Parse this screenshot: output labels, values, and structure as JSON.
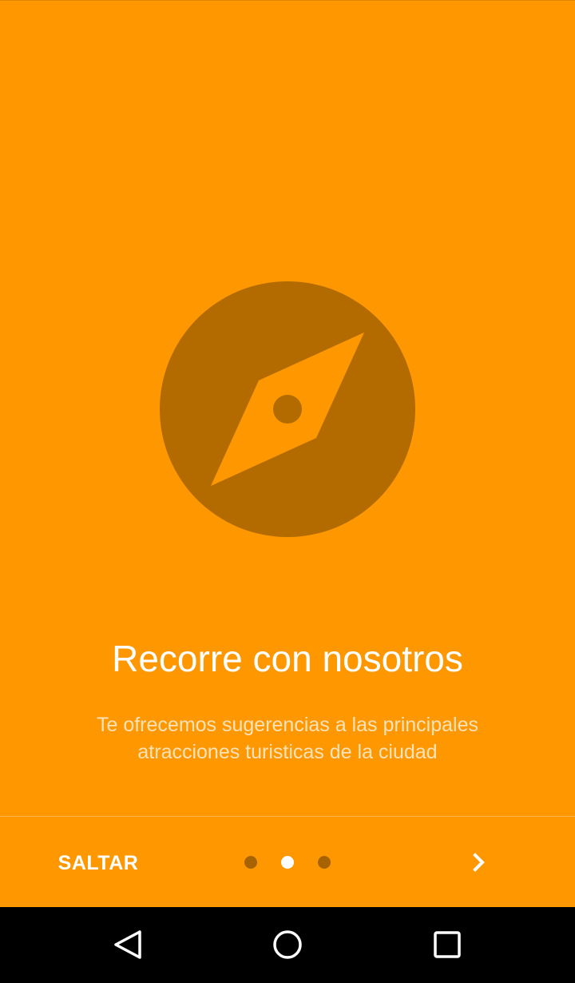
{
  "colors": {
    "background": "#FF9800",
    "icon_circle": "#B36B00",
    "title_text": "#FFFFFF",
    "description_text": "#FFE0B2",
    "nav_bar": "#000000"
  },
  "hero": {
    "icon": "compass-icon"
  },
  "slide": {
    "title": "Recorre con nosotros",
    "description_lines": [
      "Te ofrecemos sugerencias a las principales",
      "atracciones turisticas de la ciudad"
    ]
  },
  "footer": {
    "skip_label": "SALTAR",
    "next_icon": "chevron-right-icon",
    "page_indicator": {
      "total": 3,
      "current": 2
    }
  },
  "system_nav": {
    "back_icon": "back-triangle-icon",
    "home_icon": "home-circle-icon",
    "recents_icon": "recents-square-icon"
  }
}
